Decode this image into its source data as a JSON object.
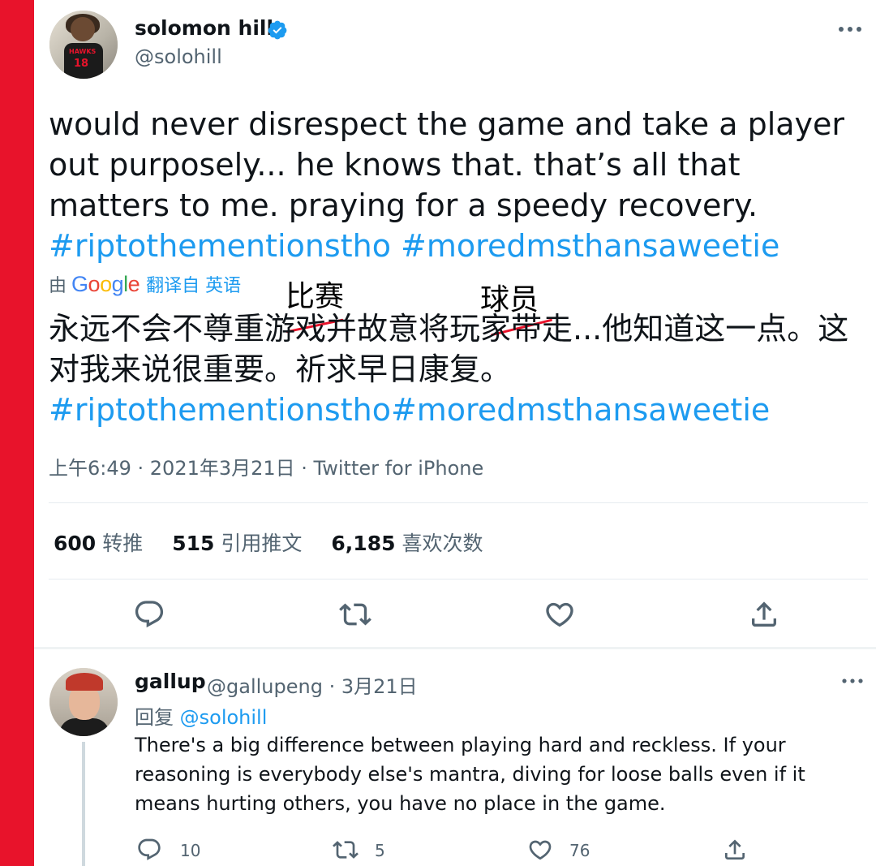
{
  "colors": {
    "accent_bar": "#e8132b",
    "link": "#1d9bf0",
    "secondary": "#536471",
    "primary": "#0f1419"
  },
  "tweet": {
    "display_name": "solomon hill",
    "verified": true,
    "handle": "@solohill",
    "text_plain": "would never disrespect the game and take a player out purposely... he knows that. that’s all that matters to me. praying for a speedy recovery. ",
    "hashtag_1": "#riptothementionstho",
    "hashtag_2": "#moredmsthansaweetie",
    "translation": {
      "prefix": "由",
      "provider_logo": "Google",
      "link_label": "翻译自 英语",
      "text": "永远不会不尊重游戏并故意将玩家带走...他知道这一点。这对我来说很重要。祈求早日康复。",
      "hashtags": "#riptothementionstho#moredmsthansaweetie"
    },
    "annotations": {
      "correction_1": "比赛",
      "correction_2": "球员"
    },
    "meta": "上午6:49 · 2021年3月21日 · Twitter for iPhone",
    "stats": [
      {
        "count": "600",
        "label": "转推"
      },
      {
        "count": "515",
        "label": "引用推文"
      },
      {
        "count": "6,185",
        "label": "喜欢次数"
      }
    ],
    "actions": [
      "reply-icon",
      "retweet-icon",
      "like-icon",
      "share-icon"
    ]
  },
  "reply": {
    "display_name": "gallup",
    "handle_date": "@gallupeng · 3月21日",
    "replying_prefix": "回复",
    "replying_to": "@solohill",
    "text": "There's a big difference between playing hard and reckless. If your reasoning is everybody else's mantra, diving for loose balls even if it means hurting others, you have no place in the game.",
    "counts": {
      "replies": "10",
      "retweets": "5",
      "likes": "76"
    }
  }
}
